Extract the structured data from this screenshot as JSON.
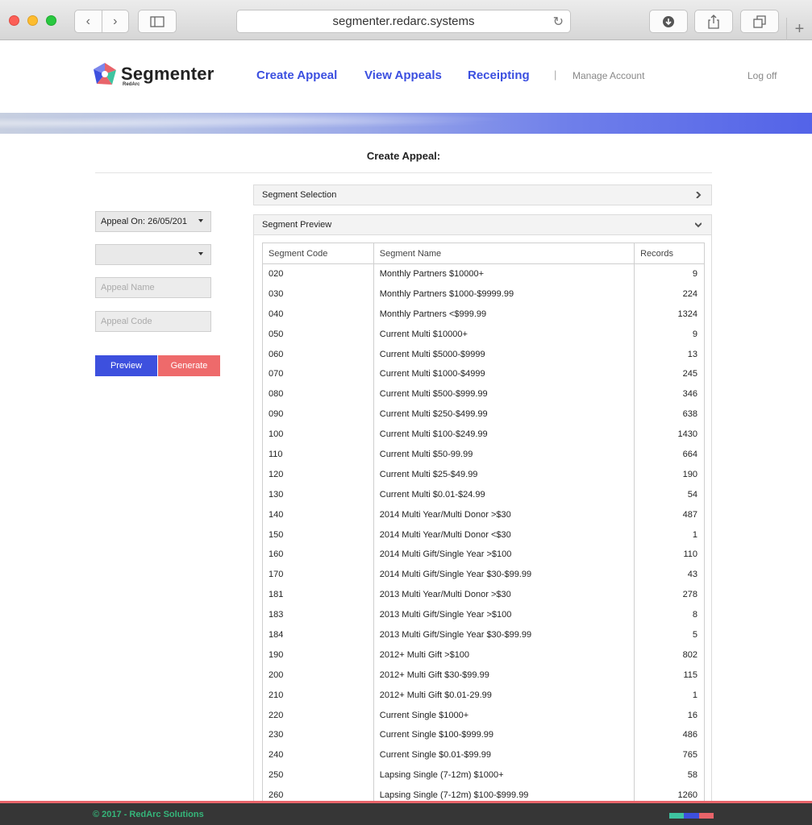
{
  "browser": {
    "url": "segmenter.redarc.systems",
    "colors": {
      "close": "#fc5f57",
      "minimize": "#fdbc2e",
      "zoom": "#29c840"
    }
  },
  "header": {
    "brand": "Segmenter",
    "brand_sub": "RedArc",
    "nav": {
      "create": "Create Appeal",
      "view": "View Appeals",
      "receipting": "Receipting",
      "separator": "|",
      "manage": "Manage Account",
      "logoff": "Log off"
    },
    "accent": "#3b4fe0"
  },
  "page": {
    "title": "Create Appeal:"
  },
  "form": {
    "appeal_on": "Appeal On: 26/05/201",
    "second_select": "",
    "appeal_name_placeholder": "Appeal Name",
    "appeal_code_placeholder": "Appeal Code",
    "preview_label": "Preview",
    "generate_label": "Generate",
    "preview_color": "#3d50de",
    "generate_color": "#ee6a6b"
  },
  "panels": {
    "selection_title": "Segment Selection",
    "preview_title": "Segment Preview"
  },
  "table": {
    "headers": [
      "Segment Code",
      "Segment Name",
      "Records"
    ],
    "rows": [
      [
        "020",
        "Monthly Partners $10000+",
        "9"
      ],
      [
        "030",
        "Monthly Partners $1000-$9999.99",
        "224"
      ],
      [
        "040",
        "Monthly Partners <$999.99",
        "1324"
      ],
      [
        "050",
        "Current Multi $10000+",
        "9"
      ],
      [
        "060",
        "Current Multi $5000-$9999",
        "13"
      ],
      [
        "070",
        "Current Multi $1000-$4999",
        "245"
      ],
      [
        "080",
        "Current Multi $500-$999.99",
        "346"
      ],
      [
        "090",
        "Current Multi $250-$499.99",
        "638"
      ],
      [
        "100",
        "Current Multi $100-$249.99",
        "1430"
      ],
      [
        "110",
        "Current Multi $50-99.99",
        "664"
      ],
      [
        "120",
        "Current Multi $25-$49.99",
        "190"
      ],
      [
        "130",
        "Current Multi $0.01-$24.99",
        "54"
      ],
      [
        "140",
        "2014 Multi Year/Multi Donor >$30",
        "487"
      ],
      [
        "150",
        "2014 Multi Year/Multi Donor <$30",
        "1"
      ],
      [
        "160",
        "2014 Multi Gift/Single Year >$100",
        "110"
      ],
      [
        "170",
        "2014 Multi Gift/Single Year $30-$99.99",
        "43"
      ],
      [
        "181",
        "2013 Multi Year/Multi Donor >$30",
        "278"
      ],
      [
        "183",
        "2013 Multi Gift/Single Year >$100",
        "8"
      ],
      [
        "184",
        "2013 Multi Gift/Single Year $30-$99.99",
        "5"
      ],
      [
        "190",
        "2012+ Multi Gift >$100",
        "802"
      ],
      [
        "200",
        "2012+ Multi Gift $30-$99.99",
        "115"
      ],
      [
        "210",
        "2012+ Multi Gift $0.01-29.99",
        "1"
      ],
      [
        "220",
        "Current Single $1000+",
        "16"
      ],
      [
        "230",
        "Current Single $100-$999.99",
        "486"
      ],
      [
        "240",
        "Current Single $0.01-$99.99",
        "765"
      ],
      [
        "250",
        "Lapsing Single (7-12m) $1000+",
        "58"
      ],
      [
        "260",
        "Lapsing Single (7-12m) $100-$999.99",
        "1260"
      ]
    ]
  },
  "footer": {
    "copyright": "© 2017 - RedArc Solutions",
    "bar_colors": [
      "#3ec4a0",
      "#3d50de",
      "#e8646a"
    ]
  }
}
